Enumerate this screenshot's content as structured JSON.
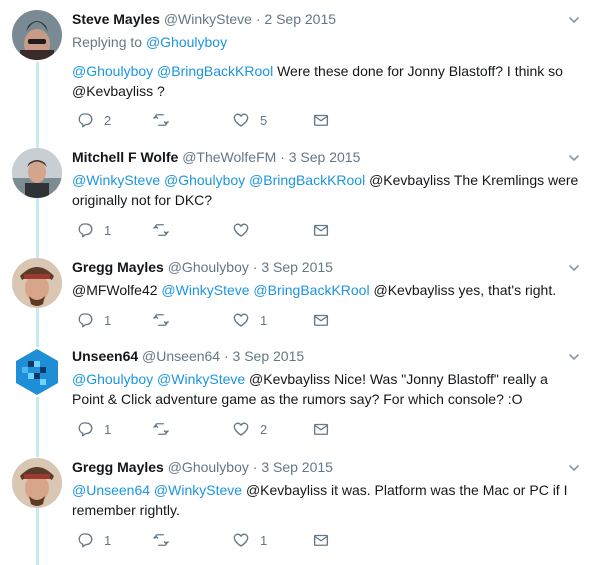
{
  "tweets": [
    {
      "name": "Steve Mayles",
      "handle": "@WinkySteve",
      "separator": "·",
      "date": "2 Sep 2015",
      "replying_prefix": "Replying to",
      "replying_to": "@Ghoulyboy",
      "mentions": "@Ghoulyboy @BringBackKRool",
      "text": " Were these done for Jonny Blastoff? I think so @Kevbayliss ?",
      "replies": "2",
      "retweets": "",
      "likes": "5",
      "avatar_icon": "avatar-mohawk-icon"
    },
    {
      "name": "Mitchell F Wolfe",
      "handle": "@TheWolfeFM",
      "separator": "·",
      "date": "3 Sep 2015",
      "mentions": "@WinkySteve @Ghoulyboy @BringBackKRool",
      "text": " @Kevbayliss The Kremlings were originally not for DKC?",
      "replies": "1",
      "retweets": "",
      "likes": "",
      "avatar_icon": "avatar-photo-icon"
    },
    {
      "name": "Gregg Mayles",
      "handle": "@Ghoulyboy",
      "separator": "·",
      "date": "3 Sep 2015",
      "lead_text": "@MFWolfe42 ",
      "mentions": "@WinkySteve @BringBackKRool",
      "text": " @Kevbayliss yes, that's right.",
      "replies": "1",
      "retweets": "",
      "likes": "1",
      "avatar_icon": "avatar-pirate-icon"
    },
    {
      "name": "Unseen64",
      "handle": "@Unseen64",
      "separator": "·",
      "date": "3 Sep 2015",
      "mentions": "@Ghoulyboy @WinkySteve",
      "text": " @Kevbayliss Nice! Was \"Jonny Blastoff\" really a Point & Click adventure game as the rumors say? For which console? :O",
      "replies": "1",
      "retweets": "",
      "likes": "2",
      "avatar_icon": "avatar-pixel-logo-icon"
    },
    {
      "name": "Gregg Mayles",
      "handle": "@Ghoulyboy",
      "separator": "·",
      "date": "3 Sep 2015",
      "mentions": "@Unseen64 @WinkySteve",
      "text": " @Kevbayliss it was. Platform was the Mac or PC if I remember rightly.",
      "replies": "1",
      "retweets": "",
      "likes": "1",
      "avatar_icon": "avatar-pirate-icon"
    }
  ],
  "colors": {
    "link": "#1b95e0",
    "muted": "#657786",
    "thread_line": "#c4ecf3"
  }
}
